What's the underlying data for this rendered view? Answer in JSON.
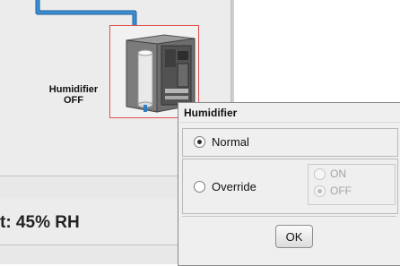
{
  "device": {
    "name_label": "Humidifier",
    "status_label": "OFF"
  },
  "reading": {
    "text": "t: 45% RH"
  },
  "colors": {
    "pipe": "#2f7fc4",
    "selection_box": "#e0504e"
  },
  "dialog": {
    "title": "Humidifier",
    "normal_label": "Normal",
    "override_label": "Override",
    "on_label": "ON",
    "off_label": "OFF",
    "ok_label": "OK",
    "selected_mode": "Normal",
    "override_selected_value": "OFF"
  }
}
